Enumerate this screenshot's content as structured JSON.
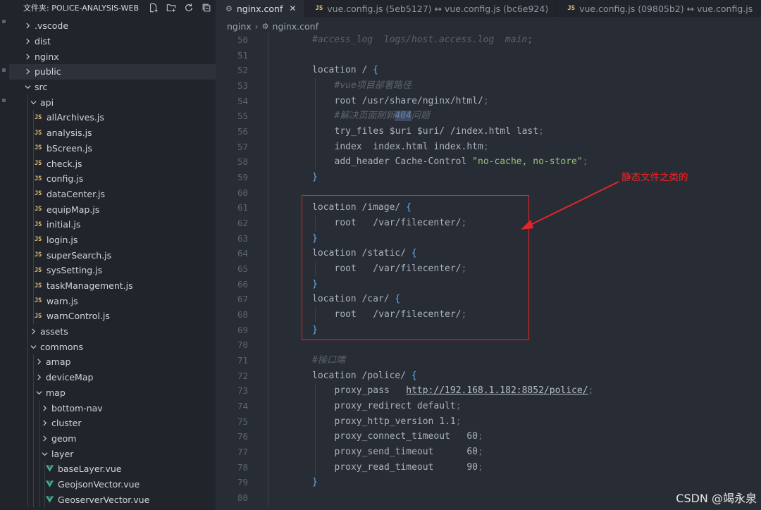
{
  "sidebar": {
    "title": "文件夹: POLICE-ANALYSIS-WEB",
    "tree": [
      {
        "label": ".vscode",
        "kind": "folder",
        "open": false,
        "depth": 0
      },
      {
        "label": "dist",
        "kind": "folder",
        "open": false,
        "depth": 0
      },
      {
        "label": "nginx",
        "kind": "folder",
        "open": false,
        "depth": 0
      },
      {
        "label": "public",
        "kind": "folder",
        "open": false,
        "depth": 0,
        "selected": true
      },
      {
        "label": "src",
        "kind": "folder",
        "open": true,
        "depth": 0
      },
      {
        "label": "api",
        "kind": "folder",
        "open": true,
        "depth": 1
      },
      {
        "label": "allArchives.js",
        "kind": "js",
        "depth": 2
      },
      {
        "label": "analysis.js",
        "kind": "js",
        "depth": 2
      },
      {
        "label": "bScreen.js",
        "kind": "js",
        "depth": 2
      },
      {
        "label": "check.js",
        "kind": "js",
        "depth": 2
      },
      {
        "label": "config.js",
        "kind": "js",
        "depth": 2
      },
      {
        "label": "dataCenter.js",
        "kind": "js",
        "depth": 2
      },
      {
        "label": "equipMap.js",
        "kind": "js",
        "depth": 2
      },
      {
        "label": "initial.js",
        "kind": "js",
        "depth": 2
      },
      {
        "label": "login.js",
        "kind": "js",
        "depth": 2
      },
      {
        "label": "superSearch.js",
        "kind": "js",
        "depth": 2
      },
      {
        "label": "sysSetting.js",
        "kind": "js",
        "depth": 2
      },
      {
        "label": "taskManagement.js",
        "kind": "js",
        "depth": 2
      },
      {
        "label": "warn.js",
        "kind": "js",
        "depth": 2
      },
      {
        "label": "warnControl.js",
        "kind": "js",
        "depth": 2
      },
      {
        "label": "assets",
        "kind": "folder",
        "open": false,
        "depth": 1
      },
      {
        "label": "commons",
        "kind": "folder",
        "open": true,
        "depth": 1
      },
      {
        "label": "amap",
        "kind": "folder",
        "open": false,
        "depth": 2
      },
      {
        "label": "deviceMap",
        "kind": "folder",
        "open": false,
        "depth": 2
      },
      {
        "label": "map",
        "kind": "folder",
        "open": true,
        "depth": 2
      },
      {
        "label": "bottom-nav",
        "kind": "folder",
        "open": false,
        "depth": 3
      },
      {
        "label": "cluster",
        "kind": "folder",
        "open": false,
        "depth": 3
      },
      {
        "label": "geom",
        "kind": "folder",
        "open": false,
        "depth": 3
      },
      {
        "label": "layer",
        "kind": "folder",
        "open": true,
        "depth": 3
      },
      {
        "label": "baseLayer.vue",
        "kind": "vue",
        "depth": 4
      },
      {
        "label": "GeojsonVector.vue",
        "kind": "vue",
        "depth": 4
      },
      {
        "label": "GeoserverVector.vue",
        "kind": "vue",
        "depth": 4
      }
    ]
  },
  "tabs": [
    {
      "label": "nginx.conf",
      "icon": "gear-icon",
      "active": true,
      "closable": true
    },
    {
      "label": "vue.config.js (5eb5127) ↔ vue.config.js (bc6e924)",
      "icon": "js-icon",
      "active": false
    },
    {
      "label": "vue.config.js (09805b2) ↔ vue.config.js",
      "icon": "js-icon",
      "active": false
    },
    {
      "label": "",
      "icon": "js-icon",
      "active": false
    }
  ],
  "breadcrumb": {
    "folder": "nginx",
    "file": "nginx.conf"
  },
  "colors": {
    "accent": "#61afef",
    "annotation": "#e0262b",
    "string": "#98c379",
    "comment": "#5c6370"
  },
  "editor": {
    "lines": [
      {
        "n": "50",
        "indent": 1,
        "tokens": [
          {
            "t": "#access_log  logs/host.access.log  main",
            "c": "comment"
          },
          {
            "t": ";",
            "c": "punct"
          }
        ]
      },
      {
        "n": "51",
        "indent": 0,
        "tokens": []
      },
      {
        "n": "52",
        "indent": 1,
        "tokens": [
          {
            "t": "location / ",
            "c": ""
          },
          {
            "t": "{",
            "c": "brace"
          }
        ]
      },
      {
        "n": "53",
        "indent": 2,
        "tokens": [
          {
            "t": "#vue项目部署路径",
            "c": "comment"
          }
        ]
      },
      {
        "n": "54",
        "indent": 2,
        "tokens": [
          {
            "t": "root /usr/share/nginx/html/",
            "c": ""
          },
          {
            "t": ";",
            "c": "punct"
          }
        ]
      },
      {
        "n": "55",
        "indent": 2,
        "tokens": [
          {
            "t": "#解决页面刷新",
            "c": "comment"
          },
          {
            "t": "404",
            "c": "hl"
          },
          {
            "t": "问题",
            "c": "comment"
          }
        ]
      },
      {
        "n": "56",
        "indent": 2,
        "tokens": [
          {
            "t": "try_files $uri $uri/ /index.html last",
            "c": ""
          },
          {
            "t": ";",
            "c": "punct"
          }
        ]
      },
      {
        "n": "57",
        "indent": 2,
        "tokens": [
          {
            "t": "index  index.html index.htm",
            "c": ""
          },
          {
            "t": ";",
            "c": "punct"
          }
        ]
      },
      {
        "n": "58",
        "indent": 2,
        "tokens": [
          {
            "t": "add_header Cache-Control ",
            "c": ""
          },
          {
            "t": "\"no-cache, no-store\"",
            "c": "str"
          },
          {
            "t": ";",
            "c": "punct"
          }
        ]
      },
      {
        "n": "59",
        "indent": 1,
        "tokens": [
          {
            "t": "}",
            "c": "brace"
          }
        ]
      },
      {
        "n": "60",
        "indent": 0,
        "tokens": []
      },
      {
        "n": "61",
        "indent": 1,
        "tokens": [
          {
            "t": "location /image/ ",
            "c": ""
          },
          {
            "t": "{",
            "c": "brace"
          }
        ]
      },
      {
        "n": "62",
        "indent": 2,
        "tokens": [
          {
            "t": "root   /var/filecenter/",
            "c": ""
          },
          {
            "t": ";",
            "c": "punct"
          }
        ]
      },
      {
        "n": "63",
        "indent": 1,
        "tokens": [
          {
            "t": "}",
            "c": "brace"
          }
        ]
      },
      {
        "n": "64",
        "indent": 1,
        "tokens": [
          {
            "t": "location /static/ ",
            "c": ""
          },
          {
            "t": "{",
            "c": "brace"
          }
        ]
      },
      {
        "n": "65",
        "indent": 2,
        "tokens": [
          {
            "t": "root   /var/filecenter/",
            "c": ""
          },
          {
            "t": ";",
            "c": "punct"
          }
        ]
      },
      {
        "n": "66",
        "indent": 1,
        "tokens": [
          {
            "t": "}",
            "c": "brace"
          }
        ]
      },
      {
        "n": "67",
        "indent": 1,
        "tokens": [
          {
            "t": "location /car/ ",
            "c": ""
          },
          {
            "t": "{",
            "c": "brace"
          }
        ]
      },
      {
        "n": "68",
        "indent": 2,
        "tokens": [
          {
            "t": "root   /var/filecenter/",
            "c": ""
          },
          {
            "t": ";",
            "c": "punct"
          }
        ]
      },
      {
        "n": "69",
        "indent": 1,
        "tokens": [
          {
            "t": "}",
            "c": "brace"
          }
        ]
      },
      {
        "n": "70",
        "indent": 0,
        "tokens": []
      },
      {
        "n": "71",
        "indent": 1,
        "tokens": [
          {
            "t": "#接口端",
            "c": "comment"
          }
        ]
      },
      {
        "n": "72",
        "indent": 1,
        "tokens": [
          {
            "t": "location /police/ ",
            "c": ""
          },
          {
            "t": "{",
            "c": "brace"
          }
        ]
      },
      {
        "n": "73",
        "indent": 2,
        "tokens": [
          {
            "t": "proxy_pass   ",
            "c": ""
          },
          {
            "t": "http://192.168.1.182:8852/police/",
            "c": "url"
          },
          {
            "t": ";",
            "c": "punct"
          }
        ]
      },
      {
        "n": "74",
        "indent": 2,
        "tokens": [
          {
            "t": "proxy_redirect default",
            "c": ""
          },
          {
            "t": ";",
            "c": "punct"
          }
        ]
      },
      {
        "n": "75",
        "indent": 2,
        "tokens": [
          {
            "t": "proxy_http_version 1.1",
            "c": ""
          },
          {
            "t": ";",
            "c": "punct"
          }
        ]
      },
      {
        "n": "76",
        "indent": 2,
        "tokens": [
          {
            "t": "proxy_connect_timeout   60",
            "c": ""
          },
          {
            "t": ";",
            "c": "punct"
          }
        ]
      },
      {
        "n": "77",
        "indent": 2,
        "tokens": [
          {
            "t": "proxy_send_timeout      60",
            "c": ""
          },
          {
            "t": ";",
            "c": "punct"
          }
        ]
      },
      {
        "n": "78",
        "indent": 2,
        "tokens": [
          {
            "t": "proxy_read_timeout      90",
            "c": ""
          },
          {
            "t": ";",
            "c": "punct"
          }
        ]
      },
      {
        "n": "79",
        "indent": 1,
        "tokens": [
          {
            "t": "}",
            "c": "brace"
          }
        ]
      },
      {
        "n": "80",
        "indent": 0,
        "tokens": []
      }
    ]
  },
  "annotation": {
    "label": "静态文件之类的"
  },
  "watermark": "CSDN @竭永泉"
}
